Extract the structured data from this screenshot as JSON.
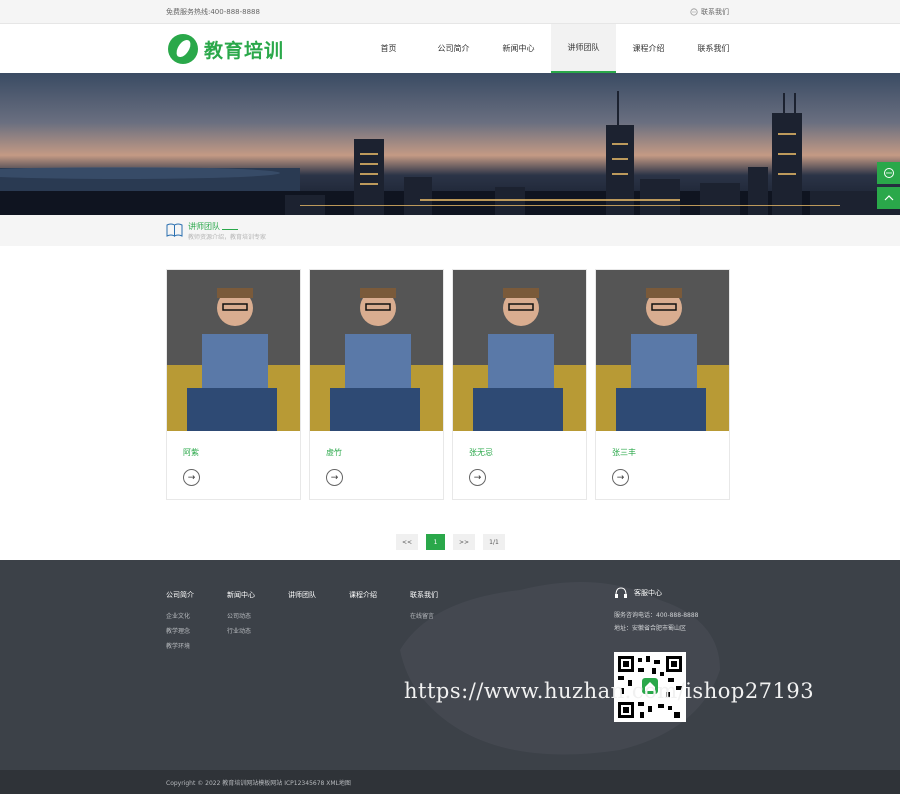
{
  "topbar": {
    "hotline": "免费服务热线:400-888-8888",
    "contact": "联系我们"
  },
  "logo": {
    "text": "教育培训"
  },
  "nav": [
    "首页",
    "公司简介",
    "新闻中心",
    "讲师团队",
    "课程介绍",
    "联系我们"
  ],
  "nav_active_index": 3,
  "breadcrumb": {
    "title": "讲师团队",
    "subtitle": "教师资源介绍，教育培训专家"
  },
  "teachers": [
    {
      "name": "阿紫"
    },
    {
      "name": "虚竹"
    },
    {
      "name": "张无忌"
    },
    {
      "name": "张三丰"
    }
  ],
  "pagination": {
    "prev": "<<",
    "current": "1",
    "next": ">>",
    "total": "1/1"
  },
  "footer": {
    "columns": [
      {
        "title": "公司简介",
        "items": [
          "企业文化",
          "教学理念",
          "教学环境"
        ]
      },
      {
        "title": "新闻中心",
        "items": [
          "公司动态",
          "行业动态"
        ]
      },
      {
        "title": "讲师团队",
        "items": []
      },
      {
        "title": "课程介绍",
        "items": []
      },
      {
        "title": "联系我们",
        "items": [
          "在线留言"
        ]
      }
    ],
    "service": {
      "title": "客服中心",
      "phone": "服务咨询电话：400-888-8888",
      "address": "地址：安徽省合肥市蜀山区"
    },
    "watermark": "https://www.huzhan.com/ishop27193",
    "copyright": "Copyright © 2022 教育培训网站模板网站 ICP12345678 XML地图"
  },
  "colors": {
    "accent": "#2aa84a",
    "footer_bg": "#3c4148"
  }
}
